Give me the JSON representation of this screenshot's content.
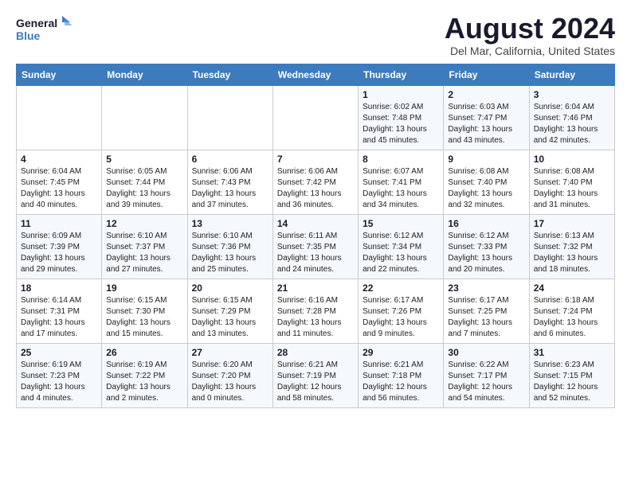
{
  "header": {
    "logo_line1": "General",
    "logo_line2": "Blue",
    "main_title": "August 2024",
    "subtitle": "Del Mar, California, United States"
  },
  "weekdays": [
    "Sunday",
    "Monday",
    "Tuesday",
    "Wednesday",
    "Thursday",
    "Friday",
    "Saturday"
  ],
  "weeks": [
    [
      {
        "day": "",
        "info": ""
      },
      {
        "day": "",
        "info": ""
      },
      {
        "day": "",
        "info": ""
      },
      {
        "day": "",
        "info": ""
      },
      {
        "day": "1",
        "info": "Sunrise: 6:02 AM\nSunset: 7:48 PM\nDaylight: 13 hours\nand 45 minutes."
      },
      {
        "day": "2",
        "info": "Sunrise: 6:03 AM\nSunset: 7:47 PM\nDaylight: 13 hours\nand 43 minutes."
      },
      {
        "day": "3",
        "info": "Sunrise: 6:04 AM\nSunset: 7:46 PM\nDaylight: 13 hours\nand 42 minutes."
      }
    ],
    [
      {
        "day": "4",
        "info": "Sunrise: 6:04 AM\nSunset: 7:45 PM\nDaylight: 13 hours\nand 40 minutes."
      },
      {
        "day": "5",
        "info": "Sunrise: 6:05 AM\nSunset: 7:44 PM\nDaylight: 13 hours\nand 39 minutes."
      },
      {
        "day": "6",
        "info": "Sunrise: 6:06 AM\nSunset: 7:43 PM\nDaylight: 13 hours\nand 37 minutes."
      },
      {
        "day": "7",
        "info": "Sunrise: 6:06 AM\nSunset: 7:42 PM\nDaylight: 13 hours\nand 36 minutes."
      },
      {
        "day": "8",
        "info": "Sunrise: 6:07 AM\nSunset: 7:41 PM\nDaylight: 13 hours\nand 34 minutes."
      },
      {
        "day": "9",
        "info": "Sunrise: 6:08 AM\nSunset: 7:40 PM\nDaylight: 13 hours\nand 32 minutes."
      },
      {
        "day": "10",
        "info": "Sunrise: 6:08 AM\nSunset: 7:40 PM\nDaylight: 13 hours\nand 31 minutes."
      }
    ],
    [
      {
        "day": "11",
        "info": "Sunrise: 6:09 AM\nSunset: 7:39 PM\nDaylight: 13 hours\nand 29 minutes."
      },
      {
        "day": "12",
        "info": "Sunrise: 6:10 AM\nSunset: 7:37 PM\nDaylight: 13 hours\nand 27 minutes."
      },
      {
        "day": "13",
        "info": "Sunrise: 6:10 AM\nSunset: 7:36 PM\nDaylight: 13 hours\nand 25 minutes."
      },
      {
        "day": "14",
        "info": "Sunrise: 6:11 AM\nSunset: 7:35 PM\nDaylight: 13 hours\nand 24 minutes."
      },
      {
        "day": "15",
        "info": "Sunrise: 6:12 AM\nSunset: 7:34 PM\nDaylight: 13 hours\nand 22 minutes."
      },
      {
        "day": "16",
        "info": "Sunrise: 6:12 AM\nSunset: 7:33 PM\nDaylight: 13 hours\nand 20 minutes."
      },
      {
        "day": "17",
        "info": "Sunrise: 6:13 AM\nSunset: 7:32 PM\nDaylight: 13 hours\nand 18 minutes."
      }
    ],
    [
      {
        "day": "18",
        "info": "Sunrise: 6:14 AM\nSunset: 7:31 PM\nDaylight: 13 hours\nand 17 minutes."
      },
      {
        "day": "19",
        "info": "Sunrise: 6:15 AM\nSunset: 7:30 PM\nDaylight: 13 hours\nand 15 minutes."
      },
      {
        "day": "20",
        "info": "Sunrise: 6:15 AM\nSunset: 7:29 PM\nDaylight: 13 hours\nand 13 minutes."
      },
      {
        "day": "21",
        "info": "Sunrise: 6:16 AM\nSunset: 7:28 PM\nDaylight: 13 hours\nand 11 minutes."
      },
      {
        "day": "22",
        "info": "Sunrise: 6:17 AM\nSunset: 7:26 PM\nDaylight: 13 hours\nand 9 minutes."
      },
      {
        "day": "23",
        "info": "Sunrise: 6:17 AM\nSunset: 7:25 PM\nDaylight: 13 hours\nand 7 minutes."
      },
      {
        "day": "24",
        "info": "Sunrise: 6:18 AM\nSunset: 7:24 PM\nDaylight: 13 hours\nand 6 minutes."
      }
    ],
    [
      {
        "day": "25",
        "info": "Sunrise: 6:19 AM\nSunset: 7:23 PM\nDaylight: 13 hours\nand 4 minutes."
      },
      {
        "day": "26",
        "info": "Sunrise: 6:19 AM\nSunset: 7:22 PM\nDaylight: 13 hours\nand 2 minutes."
      },
      {
        "day": "27",
        "info": "Sunrise: 6:20 AM\nSunset: 7:20 PM\nDaylight: 13 hours\nand 0 minutes."
      },
      {
        "day": "28",
        "info": "Sunrise: 6:21 AM\nSunset: 7:19 PM\nDaylight: 12 hours\nand 58 minutes."
      },
      {
        "day": "29",
        "info": "Sunrise: 6:21 AM\nSunset: 7:18 PM\nDaylight: 12 hours\nand 56 minutes."
      },
      {
        "day": "30",
        "info": "Sunrise: 6:22 AM\nSunset: 7:17 PM\nDaylight: 12 hours\nand 54 minutes."
      },
      {
        "day": "31",
        "info": "Sunrise: 6:23 AM\nSunset: 7:15 PM\nDaylight: 12 hours\nand 52 minutes."
      }
    ]
  ]
}
